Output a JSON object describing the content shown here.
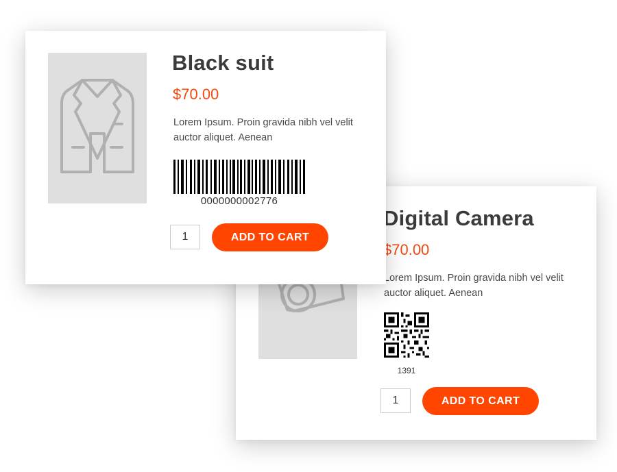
{
  "products": [
    {
      "id_label": "card-suit",
      "title": "Black suit",
      "price": "$70.00",
      "description": "Lorem Ipsum. Proin gravida nibh vel velit auctor aliquet. Aenean",
      "image_icon": "jacket-icon",
      "code_type": "barcode",
      "code_number": "0000000002776",
      "quantity": "1",
      "button_label": "ADD TO CART"
    },
    {
      "id_label": "card-camera",
      "title": "Digital Camera",
      "price": "$70.00",
      "description": "Lorem Ipsum. Proin gravida nibh vel velit auctor aliquet. Aenean",
      "image_icon": "camera-icon",
      "code_type": "qr-code",
      "code_number": "1391",
      "quantity": "1",
      "button_label": "ADD TO CART"
    }
  ],
  "colors": {
    "accent": "#ff4500",
    "price": "#f24a0f",
    "placeholder_bg": "#dfdfdf",
    "icon_stroke": "#b0b0b0"
  }
}
